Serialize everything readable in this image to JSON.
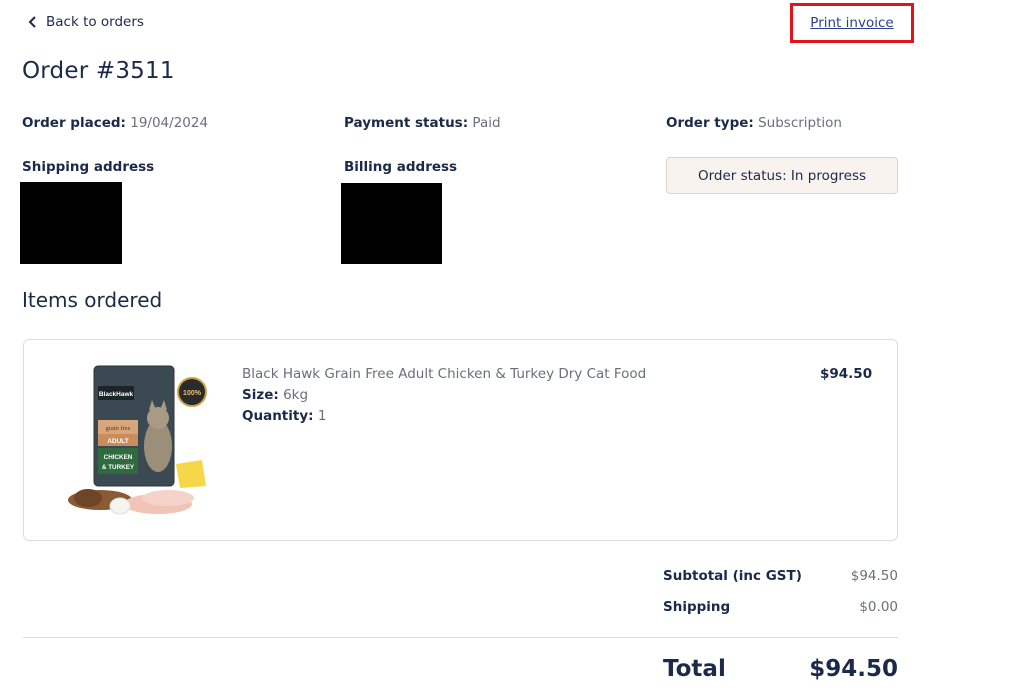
{
  "nav": {
    "back_label": "Back to orders",
    "print_label": "Print invoice"
  },
  "order": {
    "title": "Order #3511",
    "placed_label": "Order placed:",
    "placed_value": "19/04/2024",
    "payment_label": "Payment status:",
    "payment_value": "Paid",
    "type_label": "Order type:",
    "type_value": "Subscription",
    "shipping_address_label": "Shipping address",
    "billing_address_label": "Billing address",
    "status_text": "Order status: In progress"
  },
  "items": {
    "section_title": "Items ordered",
    "list": [
      {
        "name": "Black Hawk Grain Free Adult Chicken & Turkey Dry Cat Food",
        "size_label": "Size:",
        "size_value": "6kg",
        "qty_label": "Quantity:",
        "qty_value": "1",
        "price": "$94.50",
        "image_text": {
          "brand": "BlackHawk",
          "line1": "grain free",
          "line2": "ADULT",
          "line3": "CHICKEN",
          "line4": "& TURKEY",
          "seal": "100%"
        }
      }
    ]
  },
  "summary": {
    "subtotal_label": "Subtotal (inc GST)",
    "subtotal_value": "$94.50",
    "shipping_label": "Shipping",
    "shipping_value": "$0.00",
    "total_label": "Total",
    "total_value": "$94.50"
  },
  "colors": {
    "text": "#1b2a4a",
    "muted": "#6a6f7b",
    "link": "#2d3f8f",
    "highlight": "#e0141c",
    "badge_bg": "#f8f3ef"
  },
  "icons": {
    "back": "chevron-left-icon"
  }
}
